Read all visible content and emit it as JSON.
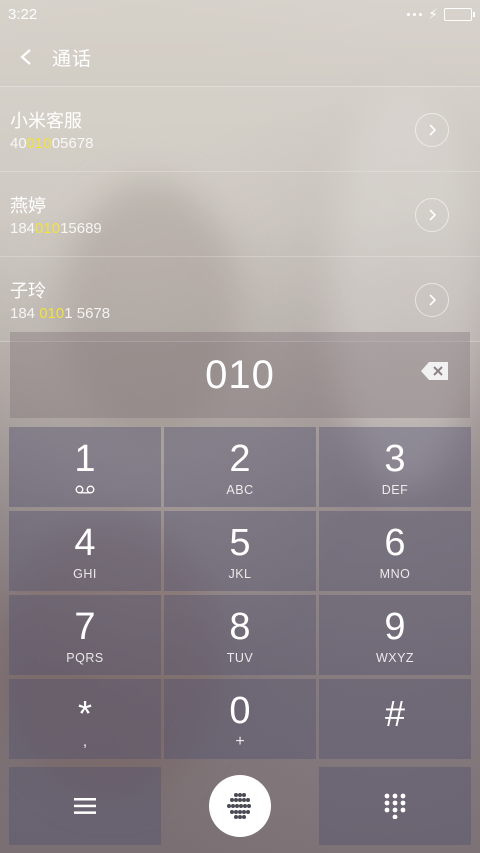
{
  "status_bar": {
    "time": "3:22"
  },
  "header": {
    "title": "通话"
  },
  "contacts": [
    {
      "name": "小米客服",
      "number_parts": [
        "40",
        "010",
        "05678"
      ]
    },
    {
      "name": "燕婷",
      "number_parts": [
        "184",
        "010",
        "15689"
      ]
    },
    {
      "name": "子玲",
      "number_parts": [
        "184 ",
        "010",
        "1 5678"
      ]
    }
  ],
  "dialer": {
    "input": "010"
  },
  "keys": [
    {
      "num": "1",
      "letters": "",
      "sub_icon": "voicemail-icon"
    },
    {
      "num": "2",
      "letters": "ABC"
    },
    {
      "num": "3",
      "letters": "DEF"
    },
    {
      "num": "4",
      "letters": "GHI"
    },
    {
      "num": "5",
      "letters": "JKL"
    },
    {
      "num": "6",
      "letters": "MNO"
    },
    {
      "num": "7",
      "letters": "PQRS"
    },
    {
      "num": "8",
      "letters": "TUV"
    },
    {
      "num": "9",
      "letters": "WXYZ"
    },
    {
      "num": "*",
      "letters": ","
    },
    {
      "num": "0",
      "letters": "+"
    },
    {
      "num": "#",
      "letters": ""
    }
  ],
  "colors": {
    "highlight": "#f3e23a"
  }
}
